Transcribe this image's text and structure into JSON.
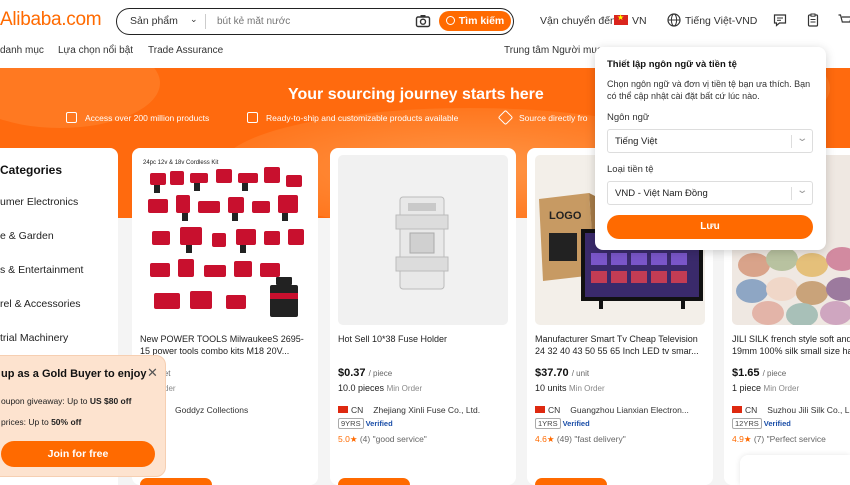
{
  "header": {
    "logo": "Alibaba.com",
    "search": {
      "category": "Sản phẩm",
      "placeholder": "bút kẻ mắt nước",
      "button": "Tìm kiếm"
    },
    "ship_to_label": "Vận chuyển đến:",
    "ship_to_country": "VN",
    "language_currency": "Tiếng Việt-VND",
    "icons": [
      "message-icon",
      "orders-icon",
      "cart-icon"
    ]
  },
  "nav": {
    "items": [
      "danh mục",
      "Lựa chọn nổi bật",
      "Trade Assurance"
    ],
    "right": "Trung tâm Người mua"
  },
  "banner": {
    "title": "Your sourcing journey starts here",
    "features": [
      "Access over 200 million products",
      "Ready-to-ship and customizable products available",
      "Source directly fro"
    ]
  },
  "categories": {
    "title": "Categories",
    "items": [
      "umer Electronics",
      "e & Garden",
      "s & Entertainment",
      "rel & Accessories",
      "trial Machinery"
    ]
  },
  "products": [
    {
      "image_text": "24pc 12v & 18v Cordless Kit",
      "title": "New POWER TOOLS MilwaukeeS 2695-15 power tools combo kits M18 20V...",
      "price": "00",
      "unit": "/ set",
      "moq": "",
      "moq_label": "Min Order",
      "country": "",
      "supplier": "Goddyz Collections",
      "years": "",
      "verified": "",
      "score": "",
      "reviews": "",
      "review_text": ""
    },
    {
      "image_text": "",
      "title": "Hot Sell 10*38 Fuse Holder",
      "price": "$0.37",
      "unit": "/ piece",
      "moq": "10.0 pieces",
      "moq_label": "Min Order",
      "country": "CN",
      "supplier": "Zhejiang Xinli Fuse Co., Ltd.",
      "years": "9YRS",
      "verified": "Verified",
      "score": "5.0",
      "reviews": "(4)",
      "review_text": "\"good service\""
    },
    {
      "image_text": "LOGO",
      "title": "Manufacturer Smart Tv Cheap Television 24 32 40 43 50 55 65 Inch LED tv smar...",
      "price": "$37.70",
      "unit": "/ unit",
      "moq": "10 units",
      "moq_label": "Min Order",
      "country": "CN",
      "supplier": "Guangzhou Lianxian Electron...",
      "years": "1YRS",
      "verified": "Verified",
      "score": "4.6",
      "reviews": "(49)",
      "review_text": "\"fast delivery\""
    },
    {
      "image_text": "",
      "title": "JILI SILK french style soft and 19mm 100% silk small size ha",
      "price": "$1.65",
      "unit": "/ piece",
      "moq": "1 piece",
      "moq_label": "Min Order",
      "country": "CN",
      "supplier": "Suzhou Jili Silk Co., L",
      "years": "12YRS",
      "verified": "Verified",
      "score": "4.9",
      "reviews": "(7)",
      "review_text": "\"Perfect service"
    }
  ],
  "gold_popup": {
    "title": "up as a Gold Buyer to enjoy",
    "line1_prefix": "oupon giveaway: Up to ",
    "line1_value": "US $80 off",
    "line2_prefix": "prices: Up to ",
    "line2_value": "50% off",
    "button": "Join for free"
  },
  "settings_popup": {
    "title": "Thiết lập ngôn ngữ và tiền tệ",
    "description": "Chọn ngôn ngữ và đơn vị tiền tệ bạn ưa thích. Bạn có thể cập nhật cài đặt bất cứ lúc nào.",
    "language_label": "Ngôn ngữ",
    "language_value": "Tiếng Việt",
    "currency_label": "Loại tiền tệ",
    "currency_value": "VND - Việt Nam Đồng",
    "save": "Lưu"
  },
  "colors": {
    "brand": "#ff6a00",
    "banner": "#ff6a0e",
    "gold_bg": "#fde3cf"
  }
}
